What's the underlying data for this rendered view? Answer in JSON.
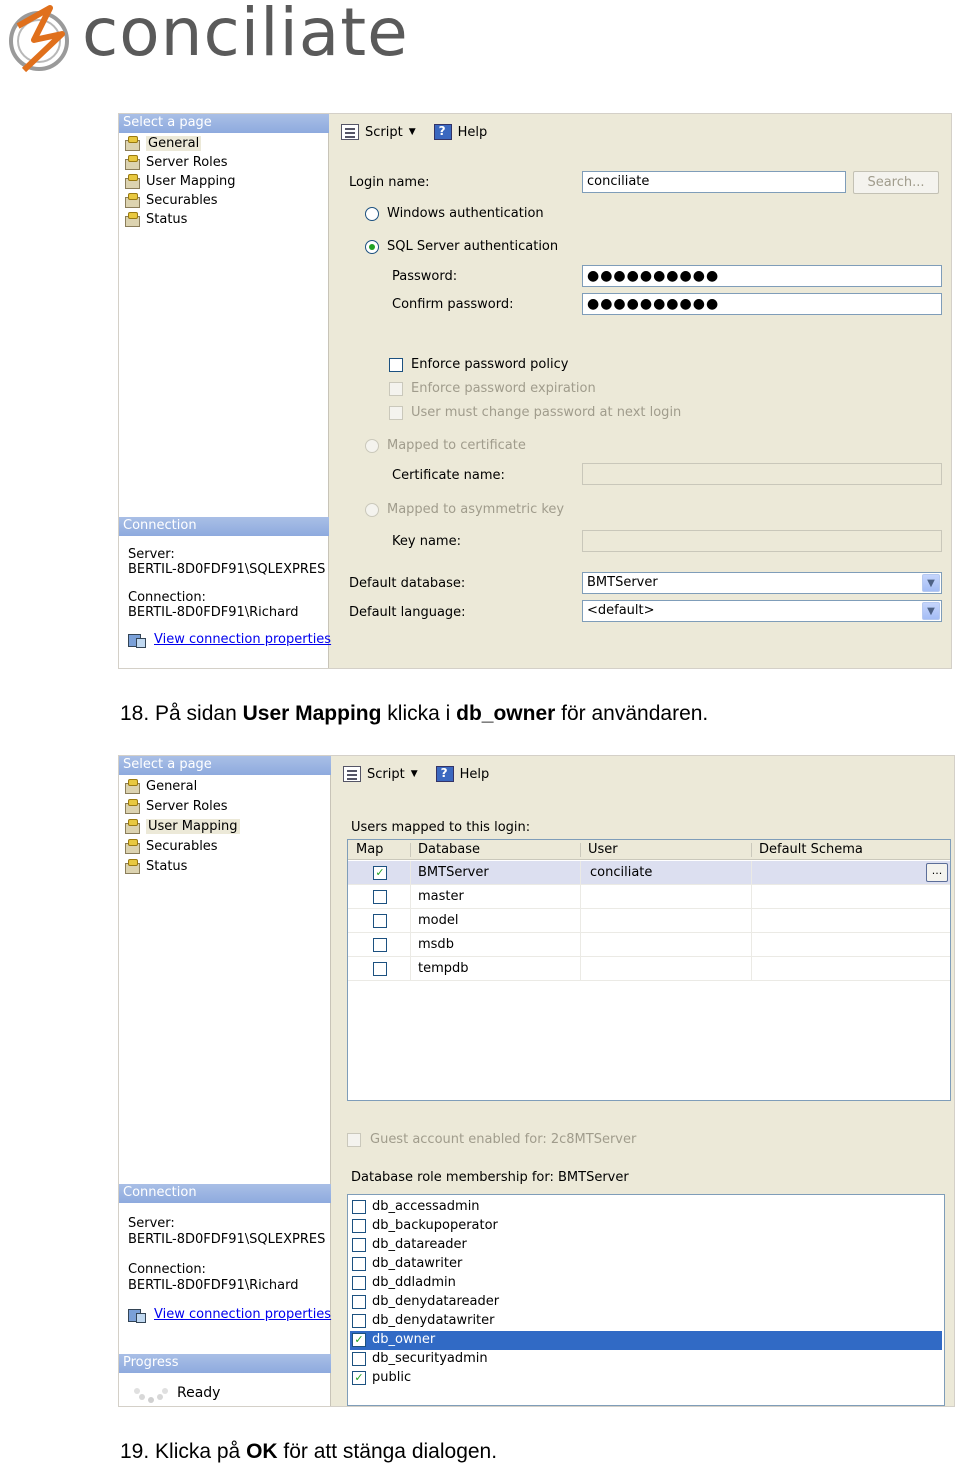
{
  "logo": {
    "text": "conciliate"
  },
  "captions": {
    "step18": {
      "num": "18. ",
      "pre": "På sidan ",
      "b1": "User Mapping",
      "mid": " klicka i ",
      "b2": "db_owner",
      "post": " för användaren."
    },
    "step19": {
      "num": "19. ",
      "pre": "Klicka på ",
      "b1": "OK",
      "post": " för att stänga dialogen."
    }
  },
  "sidebar": {
    "select_page": "Select a page",
    "items": [
      "General",
      "Server Roles",
      "User Mapping",
      "Securables",
      "Status"
    ],
    "connection": "Connection",
    "server_label": "Server:",
    "server_value": "BERTIL-8D0FDF91\\SQLEXPRES",
    "connection_label": "Connection:",
    "connection_value": "BERTIL-8D0FDF91\\Richard",
    "view_props": "View connection properties",
    "progress": "Progress",
    "ready": "Ready"
  },
  "toolbar": {
    "script": "Script",
    "help": "Help"
  },
  "general": {
    "login_name_label": "Login name:",
    "login_name_value": "conciliate",
    "search_button": "Search...",
    "windows_auth": "Windows authentication",
    "sql_auth": "SQL Server authentication",
    "password_label": "Password:",
    "password_value": "●●●●●●●●●●",
    "confirm_label": "Confirm password:",
    "confirm_value": "●●●●●●●●●●",
    "enforce_policy": "Enforce password policy",
    "enforce_expiration": "Enforce password expiration",
    "must_change": "User must change password at next login",
    "mapped_cert": "Mapped to certificate",
    "cert_name_label": "Certificate name:",
    "mapped_key": "Mapped to asymmetric key",
    "key_name_label": "Key name:",
    "default_db_label": "Default database:",
    "default_db_value": "BMTServer",
    "default_lang_label": "Default language:",
    "default_lang_value": "<default>"
  },
  "mapping": {
    "users_mapped": "Users mapped to this login:",
    "columns": [
      "Map",
      "Database",
      "User",
      "Default Schema"
    ],
    "rows": [
      {
        "map": true,
        "database": "BMTServer",
        "user": "conciliate",
        "schema": ""
      },
      {
        "map": false,
        "database": "master",
        "user": "",
        "schema": ""
      },
      {
        "map": false,
        "database": "model",
        "user": "",
        "schema": ""
      },
      {
        "map": false,
        "database": "msdb",
        "user": "",
        "schema": ""
      },
      {
        "map": false,
        "database": "tempdb",
        "user": "",
        "schema": ""
      }
    ],
    "ellipsis": "...",
    "guest": "Guest account enabled for: 2c8MTServer",
    "role_membership": "Database role membership for: BMTServer",
    "roles": [
      {
        "name": "db_accessadmin",
        "checked": false
      },
      {
        "name": "db_backupoperator",
        "checked": false
      },
      {
        "name": "db_datareader",
        "checked": false
      },
      {
        "name": "db_datawriter",
        "checked": false
      },
      {
        "name": "db_ddladmin",
        "checked": false
      },
      {
        "name": "db_denydatareader",
        "checked": false
      },
      {
        "name": "db_denydatawriter",
        "checked": false
      },
      {
        "name": "db_owner",
        "checked": true
      },
      {
        "name": "db_securityadmin",
        "checked": false
      },
      {
        "name": "public",
        "checked": true
      }
    ]
  }
}
